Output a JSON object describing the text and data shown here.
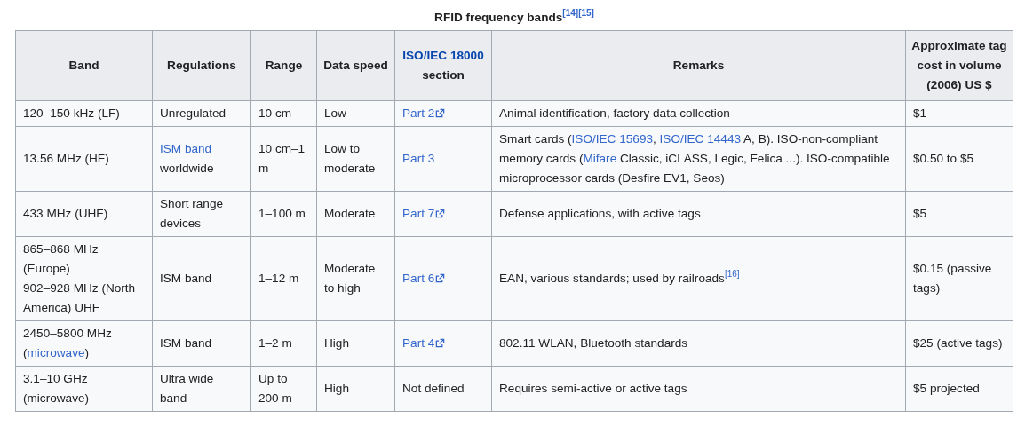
{
  "caption": {
    "text": "RFID frequency bands",
    "refs": [
      "[14]",
      "[15]"
    ]
  },
  "columns": [
    [
      {
        "kind": "text",
        "text": "Band"
      }
    ],
    [
      {
        "kind": "text",
        "text": "Regulations"
      }
    ],
    [
      {
        "kind": "text",
        "text": "Range"
      }
    ],
    [
      {
        "kind": "text",
        "text": "Data speed"
      }
    ],
    [
      {
        "kind": "link",
        "text": "ISO/IEC 18000"
      },
      {
        "kind": "text",
        "text": " section"
      }
    ],
    [
      {
        "kind": "text",
        "text": "Remarks"
      }
    ],
    [
      {
        "kind": "text",
        "text": "Approximate tag cost in volume (2006) US $"
      }
    ]
  ],
  "rows": [
    [
      [
        {
          "kind": "text",
          "text": "120–150 kHz (LF)"
        }
      ],
      [
        {
          "kind": "text",
          "text": "Unregulated"
        }
      ],
      [
        {
          "kind": "text",
          "text": "10 cm"
        }
      ],
      [
        {
          "kind": "text",
          "text": "Low"
        }
      ],
      [
        {
          "kind": "extlink",
          "text": "Part 2"
        }
      ],
      [
        {
          "kind": "text",
          "text": "Animal identification, factory data collection"
        }
      ],
      [
        {
          "kind": "text",
          "text": "$1"
        }
      ]
    ],
    [
      [
        {
          "kind": "text",
          "text": "13.56 MHz (HF)"
        }
      ],
      [
        {
          "kind": "link",
          "text": "ISM band"
        },
        {
          "kind": "text",
          "text": " worldwide"
        }
      ],
      [
        {
          "kind": "text",
          "text": "10 cm–1 m"
        }
      ],
      [
        {
          "kind": "text",
          "text": "Low to moderate"
        }
      ],
      [
        {
          "kind": "link",
          "text": "Part 3"
        }
      ],
      [
        {
          "kind": "text",
          "text": "Smart cards ("
        },
        {
          "kind": "link",
          "text": "ISO/IEC 15693"
        },
        {
          "kind": "text",
          "text": ", "
        },
        {
          "kind": "link",
          "text": "ISO/IEC 14443"
        },
        {
          "kind": "text",
          "text": " A, B). ISO-non-compliant memory cards ("
        },
        {
          "kind": "link",
          "text": "Mifare"
        },
        {
          "kind": "text",
          "text": " Classic, iCLASS, Legic, Felica ...). ISO-compatible microprocessor cards (Desfire EV1, Seos)"
        }
      ],
      [
        {
          "kind": "text",
          "text": "$0.50 to $5"
        }
      ]
    ],
    [
      [
        {
          "kind": "text",
          "text": "433 MHz (UHF)"
        }
      ],
      [
        {
          "kind": "text",
          "text": "Short range devices"
        }
      ],
      [
        {
          "kind": "text",
          "text": "1–100 m"
        }
      ],
      [
        {
          "kind": "text",
          "text": "Moderate"
        }
      ],
      [
        {
          "kind": "extlink",
          "text": "Part 7"
        }
      ],
      [
        {
          "kind": "text",
          "text": "Defense applications, with active tags"
        }
      ],
      [
        {
          "kind": "text",
          "text": "$5"
        }
      ]
    ],
    [
      [
        {
          "kind": "text",
          "text": "865–868 MHz (Europe)"
        },
        {
          "kind": "break"
        },
        {
          "kind": "text",
          "text": "902–928 MHz (North America) UHF"
        }
      ],
      [
        {
          "kind": "text",
          "text": "ISM band"
        }
      ],
      [
        {
          "kind": "text",
          "text": "1–12 m"
        }
      ],
      [
        {
          "kind": "text",
          "text": "Moderate to high"
        }
      ],
      [
        {
          "kind": "extlink",
          "text": "Part 6"
        }
      ],
      [
        {
          "kind": "text",
          "text": "EAN, various standards; used by railroads"
        },
        {
          "kind": "ref",
          "text": "[16]"
        }
      ],
      [
        {
          "kind": "text",
          "text": "$0.15 (passive tags)"
        }
      ]
    ],
    [
      [
        {
          "kind": "text",
          "text": "2450–5800 MHz ("
        },
        {
          "kind": "link",
          "text": "microwave"
        },
        {
          "kind": "text",
          "text": ")"
        }
      ],
      [
        {
          "kind": "text",
          "text": "ISM band"
        }
      ],
      [
        {
          "kind": "text",
          "text": "1–2 m"
        }
      ],
      [
        {
          "kind": "text",
          "text": "High"
        }
      ],
      [
        {
          "kind": "extlink",
          "text": "Part 4"
        }
      ],
      [
        {
          "kind": "text",
          "text": "802.11 WLAN, Bluetooth standards"
        }
      ],
      [
        {
          "kind": "text",
          "text": "$25 (active tags)"
        }
      ]
    ],
    [
      [
        {
          "kind": "text",
          "text": "3.1–10 GHz (microwave)"
        }
      ],
      [
        {
          "kind": "text",
          "text": "Ultra wide band"
        }
      ],
      [
        {
          "kind": "text",
          "text": "Up to 200 m"
        }
      ],
      [
        {
          "kind": "text",
          "text": "High"
        }
      ],
      [
        {
          "kind": "text",
          "text": "Not defined"
        }
      ],
      [
        {
          "kind": "text",
          "text": "Requires semi-active or active tags"
        }
      ],
      [
        {
          "kind": "text",
          "text": "$5 projected"
        }
      ]
    ]
  ]
}
